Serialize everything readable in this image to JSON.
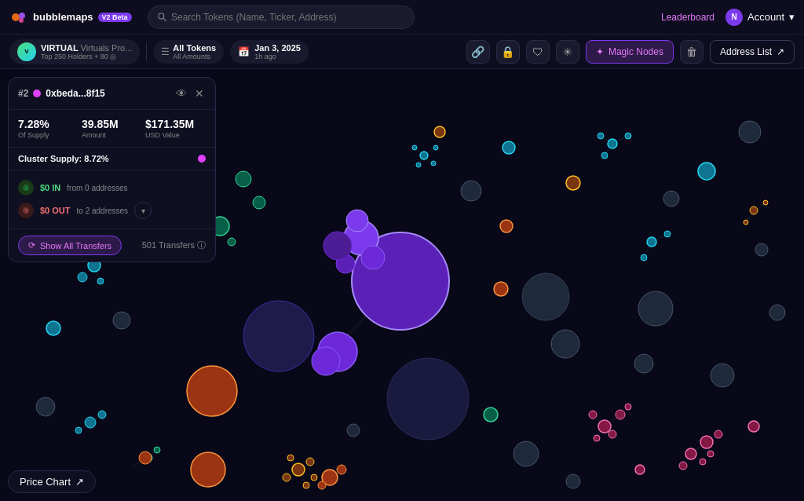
{
  "app": {
    "name": "bubblemaps",
    "version": "V2 Beta"
  },
  "nav": {
    "search_placeholder": "Search Tokens (Name, Ticker, Address)",
    "leaderboard": "Leaderboard",
    "account": "Account",
    "account_initial": "N",
    "address_list": "Address List"
  },
  "toolbar": {
    "token_name": "VIRTUAL",
    "token_full": "Virtuals Pro...",
    "token_sub": "Top 250 Holders + 80 ◎",
    "filter_label": "All Tokens",
    "filter_sub": "All Amounts",
    "date_label": "Jan 3, 2025",
    "date_sub": "1h ago",
    "magic_nodes": "Magic Nodes"
  },
  "node_panel": {
    "rank": "#2",
    "dot_color": "#e040fb",
    "address": "0xbeda...8f15",
    "supply_pct": "7.28%",
    "supply_label": "Of Supply",
    "amount": "39.85M",
    "amount_label": "Amount",
    "usd_value": "$171.35M",
    "usd_label": "USD Value",
    "cluster_label": "Cluster Supply: 8.72%",
    "transfer_in_amount": "$0 IN",
    "transfer_in_from": "from 0 addresses",
    "transfer_out_amount": "$0 OUT",
    "transfer_out_to": "to 2 addresses",
    "show_transfers": "Show All Transfers",
    "transfers_count": "501 Transfers ⓘ"
  },
  "price_chart": {
    "label": "Price Chart",
    "icon": "↗"
  }
}
